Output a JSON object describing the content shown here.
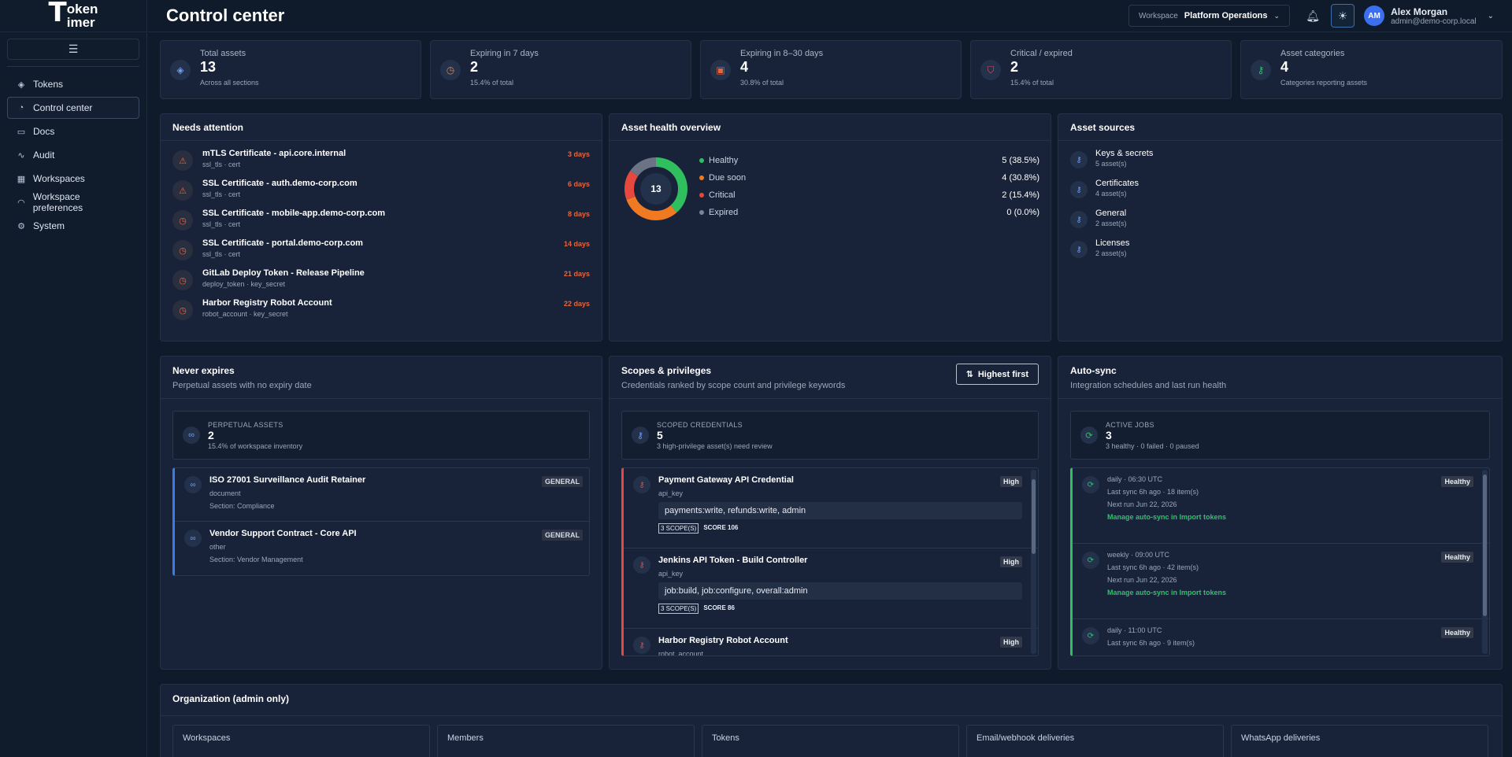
{
  "sidebar": {
    "logo_big": "T",
    "logo_top": "oken",
    "logo_bottom": "imer",
    "items": [
      {
        "label": "Tokens"
      },
      {
        "label": "Control center"
      },
      {
        "label": "Docs"
      },
      {
        "label": "Audit"
      },
      {
        "label": "Workspaces"
      },
      {
        "label": "Workspace preferences"
      },
      {
        "label": "System"
      }
    ]
  },
  "header": {
    "title": "Control center",
    "workspace_label": "Workspace",
    "workspace_value": "Platform Operations",
    "user_initials": "AM",
    "user_name": "Alex Morgan",
    "user_email": "admin@demo-corp.local"
  },
  "stats": [
    {
      "label": "Total assets",
      "value": "13",
      "sub": "Across all sections",
      "color": "#6f9ef5"
    },
    {
      "label": "Expiring in 7 days",
      "value": "2",
      "sub": "15.4% of total",
      "color": "#e8843a"
    },
    {
      "label": "Expiring in 8–30 days",
      "value": "4",
      "sub": "30.8% of total",
      "color": "#e8643a"
    },
    {
      "label": "Critical / expired",
      "value": "2",
      "sub": "15.4% of total",
      "color": "#e05050"
    },
    {
      "label": "Asset categories",
      "value": "4",
      "sub": "Categories reporting assets",
      "color": "#30c06a"
    }
  ],
  "needs_attention": {
    "title": "Needs attention",
    "items": [
      {
        "title": "mTLS Certificate - api.core.internal",
        "sub": "ssl_tls · cert",
        "days": "3 days",
        "icon": "warning"
      },
      {
        "title": "SSL Certificate - auth.demo-corp.com",
        "sub": "ssl_tls · cert",
        "days": "6 days",
        "icon": "warning"
      },
      {
        "title": "SSL Certificate - mobile-app.demo-corp.com",
        "sub": "ssl_tls · cert",
        "days": "8 days",
        "icon": "clock"
      },
      {
        "title": "SSL Certificate - portal.demo-corp.com",
        "sub": "ssl_tls · cert",
        "days": "14 days",
        "icon": "clock"
      },
      {
        "title": "GitLab Deploy Token - Release Pipeline",
        "sub": "deploy_token · key_secret",
        "days": "21 days",
        "icon": "clock"
      },
      {
        "title": "Harbor Registry Robot Account",
        "sub": "robot_account · key_secret",
        "days": "22 days",
        "icon": "clock"
      }
    ]
  },
  "health": {
    "title": "Asset health overview",
    "total": "13",
    "legend": [
      {
        "label": "Healthy",
        "value": "5 (38.5%)",
        "color": "#2fbf5e",
        "count": 5
      },
      {
        "label": "Due soon",
        "value": "4 (30.8%)",
        "color": "#f07a22",
        "count": 4
      },
      {
        "label": "Critical",
        "value": "2 (15.4%)",
        "color": "#e5483f",
        "count": 2
      },
      {
        "label": "Expired",
        "value": "0 (0.0%)",
        "color": "#7a8496",
        "count": 0
      }
    ],
    "remainder_color": "#6b7385"
  },
  "sources": {
    "title": "Asset sources",
    "items": [
      {
        "name": "Keys & secrets",
        "count": "5 asset(s)"
      },
      {
        "name": "Certificates",
        "count": "4 asset(s)"
      },
      {
        "name": "General",
        "count": "2 asset(s)"
      },
      {
        "name": "Licenses",
        "count": "2 asset(s)"
      }
    ]
  },
  "never_expires": {
    "title": "Never expires",
    "subtitle": "Perpetual assets with no expiry date",
    "summary_label": "PERPETUAL ASSETS",
    "summary_value": "2",
    "summary_sub": "15.4% of workspace inventory",
    "items": [
      {
        "title": "ISO 27001 Surveillance Audit Retainer",
        "type": "document",
        "section": "Section: Compliance",
        "tag": "GENERAL"
      },
      {
        "title": "Vendor Support Contract - Core API",
        "type": "other",
        "section": "Section: Vendor Management",
        "tag": "GENERAL"
      }
    ]
  },
  "scopes": {
    "title": "Scopes & privileges",
    "subtitle": "Credentials ranked by scope count and privilege keywords",
    "sort_label": "Highest first",
    "summary_label": "SCOPED CREDENTIALS",
    "summary_value": "5",
    "summary_sub": "3 high-privilege asset(s) need review",
    "items": [
      {
        "title": "Payment Gateway API Credential",
        "type": "api_key",
        "scopes": "payments:write, refunds:write, admin",
        "count": "3 SCOPE(S)",
        "score": "SCORE 106",
        "level": "High"
      },
      {
        "title": "Jenkins API Token - Build Controller",
        "type": "api_key",
        "scopes": "job:build, job:configure, overall:admin",
        "count": "3 SCOPE(S)",
        "score": "SCORE 86",
        "level": "High"
      },
      {
        "title": "Harbor Registry Robot Account",
        "type": "robot_account",
        "level": "High"
      }
    ]
  },
  "autosync": {
    "title": "Auto-sync",
    "subtitle": "Integration schedules and last run health",
    "summary_label": "ACTIVE JOBS",
    "summary_value": "3",
    "summary_sub": "3 healthy · 0 failed · 0 paused",
    "items": [
      {
        "schedule": "daily · 06:30 UTC",
        "last": "Last sync 6h ago · 18 item(s)",
        "next": "Next run Jun 22, 2026",
        "link": "Manage auto-sync in Import tokens",
        "status": "Healthy"
      },
      {
        "schedule": "weekly · 09:00 UTC",
        "last": "Last sync 6h ago · 42 item(s)",
        "next": "Next run Jun 22, 2026",
        "link": "Manage auto-sync in Import tokens",
        "status": "Healthy"
      },
      {
        "schedule": "daily · 11:00 UTC",
        "last": "Last sync 6h ago · 9 item(s)",
        "status": "Healthy"
      }
    ]
  },
  "organization": {
    "title": "Organization (admin only)",
    "boxes": [
      {
        "label": "Workspaces"
      },
      {
        "label": "Members"
      },
      {
        "label": "Tokens"
      },
      {
        "label": "Email/webhook deliveries"
      },
      {
        "label": "WhatsApp deliveries"
      }
    ]
  }
}
